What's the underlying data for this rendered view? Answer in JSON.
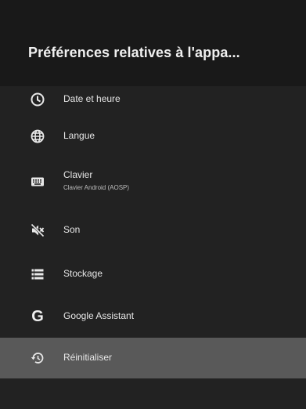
{
  "header": {
    "title": "Préférences relatives à l'appa..."
  },
  "menu": {
    "items": [
      {
        "label": "Date et heure",
        "icon": "clock-icon"
      },
      {
        "label": "Langue",
        "icon": "globe-icon"
      },
      {
        "label": "Clavier",
        "sublabel": "Clavier Android (AOSP)",
        "icon": "keyboard-icon"
      },
      {
        "label": "Son",
        "icon": "sound-off-icon"
      },
      {
        "label": "Stockage",
        "icon": "storage-list-icon"
      },
      {
        "label": "Google Assistant",
        "icon": "google-g-icon",
        "glyph": "G"
      },
      {
        "label": "Réinitialiser",
        "icon": "restore-icon"
      }
    ]
  },
  "colors": {
    "background": "#222222",
    "header_background": "#191919",
    "selected_row": "#595959",
    "text": "#e6e6e6"
  }
}
